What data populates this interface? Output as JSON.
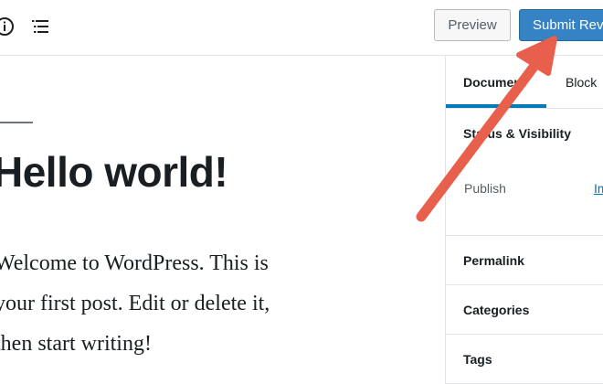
{
  "toolbar": {
    "icons": [
      "info-icon",
      "list-view-icon"
    ],
    "preview_label": "Preview",
    "submit_label": "Submit Review"
  },
  "editor": {
    "title": "Hello world!",
    "body_lines": [
      "Welcome to WordPress. This is",
      "your first post. Edit or delete it,",
      "then start writing!"
    ]
  },
  "sidebar": {
    "tabs": [
      {
        "label": "Document",
        "active": true
      },
      {
        "label": "Block",
        "active": false
      }
    ],
    "status_visibility": {
      "heading": "Status & Visibility",
      "publish_label": "Publish",
      "publish_value": "Immediately"
    },
    "panels": [
      "Permalink",
      "Categories",
      "Tags"
    ]
  },
  "colors": {
    "primary": "#3582c4",
    "tab_active": "#007cba",
    "arrow": "#e8604c"
  }
}
